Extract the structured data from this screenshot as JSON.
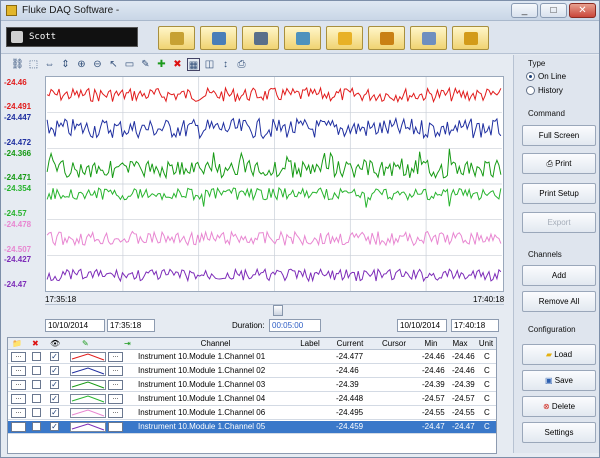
{
  "window": {
    "title": "Fluke DAQ Software -",
    "buttons": {
      "minimize": "_",
      "maximize": "□",
      "close": "✕"
    }
  },
  "toolbar": {
    "user": "Scott",
    "buttons": [
      {
        "name": "lock",
        "color": "#c7a133"
      },
      {
        "name": "user-settings",
        "color": "#4a7eb8"
      },
      {
        "name": "list",
        "color": "#5a6f8a"
      },
      {
        "name": "network",
        "color": "#4f92bd"
      },
      {
        "name": "chart",
        "color": "#e8b126"
      },
      {
        "name": "heat",
        "color": "#c98014"
      },
      {
        "name": "mail",
        "color": "#6f8fbf"
      },
      {
        "name": "close",
        "color": "#d39b19"
      }
    ]
  },
  "chart_data": {
    "type": "line",
    "x_start": "17:35:18",
    "x_end": "17:40:18",
    "series": [
      {
        "color": "#e11b1b"
      },
      {
        "color": "#1f2fa0"
      },
      {
        "color": "#169a14"
      },
      {
        "color": "#27b42e"
      },
      {
        "color": "#e886d1"
      },
      {
        "color": "#7d2cb8"
      }
    ],
    "y_labels": [
      {
        "text": "-24.46",
        "color": "#e11b1b"
      },
      {
        "text": "-24.491",
        "color": "#e11b1b"
      },
      {
        "text": "-24.447",
        "color": "#1f2fa0"
      },
      {
        "text": "-24.472",
        "color": "#1f2fa0"
      },
      {
        "text": "-24.366",
        "color": "#169a14"
      },
      {
        "text": "-24.471",
        "color": "#169a14"
      },
      {
        "text": "-24.354",
        "color": "#27b42e"
      },
      {
        "text": "-24.57",
        "color": "#27b42e"
      },
      {
        "text": "-24.478",
        "color": "#e886d1"
      },
      {
        "text": "-24.507",
        "color": "#e886d1"
      },
      {
        "text": "-24.427",
        "color": "#7d2cb8"
      },
      {
        "text": "-24.47",
        "color": "#7d2cb8"
      }
    ]
  },
  "controls": {
    "start_date": "10/10/2014",
    "start_time": "17:35:18",
    "duration_label": "Duration:",
    "duration": "00:05:00",
    "end_date": "10/10/2014",
    "end_time": "17:40:18"
  },
  "table": {
    "headers": [
      "Channel",
      "Label",
      "Current",
      "Cursor",
      "Min",
      "Max",
      "Unit"
    ],
    "rows": [
      {
        "channel": "Instrument 10.Module 1.Channel 01",
        "label": "",
        "current": "-24.477",
        "cursor": "",
        "min": "-24.46",
        "max": "-24.46",
        "unit": "C",
        "color": "#e11b1b",
        "selected": false
      },
      {
        "channel": "Instrument 10.Module 1.Channel 02",
        "label": "",
        "current": "-24.46",
        "cursor": "",
        "min": "-24.46",
        "max": "-24.46",
        "unit": "C",
        "color": "#1f2fa0",
        "selected": false
      },
      {
        "channel": "Instrument 10.Module 1.Channel 03",
        "label": "",
        "current": "-24.39",
        "cursor": "",
        "min": "-24.39",
        "max": "-24.39",
        "unit": "C",
        "color": "#169a14",
        "selected": false
      },
      {
        "channel": "Instrument 10.Module 1.Channel 04",
        "label": "",
        "current": "-24.448",
        "cursor": "",
        "min": "-24.57",
        "max": "-24.57",
        "unit": "C",
        "color": "#27b42e",
        "selected": false
      },
      {
        "channel": "Instrument 10.Module 1.Channel 06",
        "label": "",
        "current": "-24.495",
        "cursor": "",
        "min": "-24.55",
        "max": "-24.55",
        "unit": "C",
        "color": "#e886d1",
        "selected": false
      },
      {
        "channel": "Instrument 10.Module 1.Channel 05",
        "label": "",
        "current": "-24.459",
        "cursor": "",
        "min": "-24.47",
        "max": "-24.47",
        "unit": "C",
        "color": "#7d2cb8",
        "selected": true
      }
    ],
    "mini_btn": "..."
  },
  "side": {
    "type_title": "Type",
    "online": "On Line",
    "history": "History",
    "command_title": "Command",
    "full_screen": "Full Screen",
    "print": "Print",
    "print_setup": "Print Setup",
    "export": "Export",
    "channels_title": "Channels",
    "add": "Add",
    "remove_all": "Remove All",
    "config_title": "Configuration",
    "load": "Load",
    "save": "Save",
    "delete": "Delete",
    "settings": "Settings"
  }
}
